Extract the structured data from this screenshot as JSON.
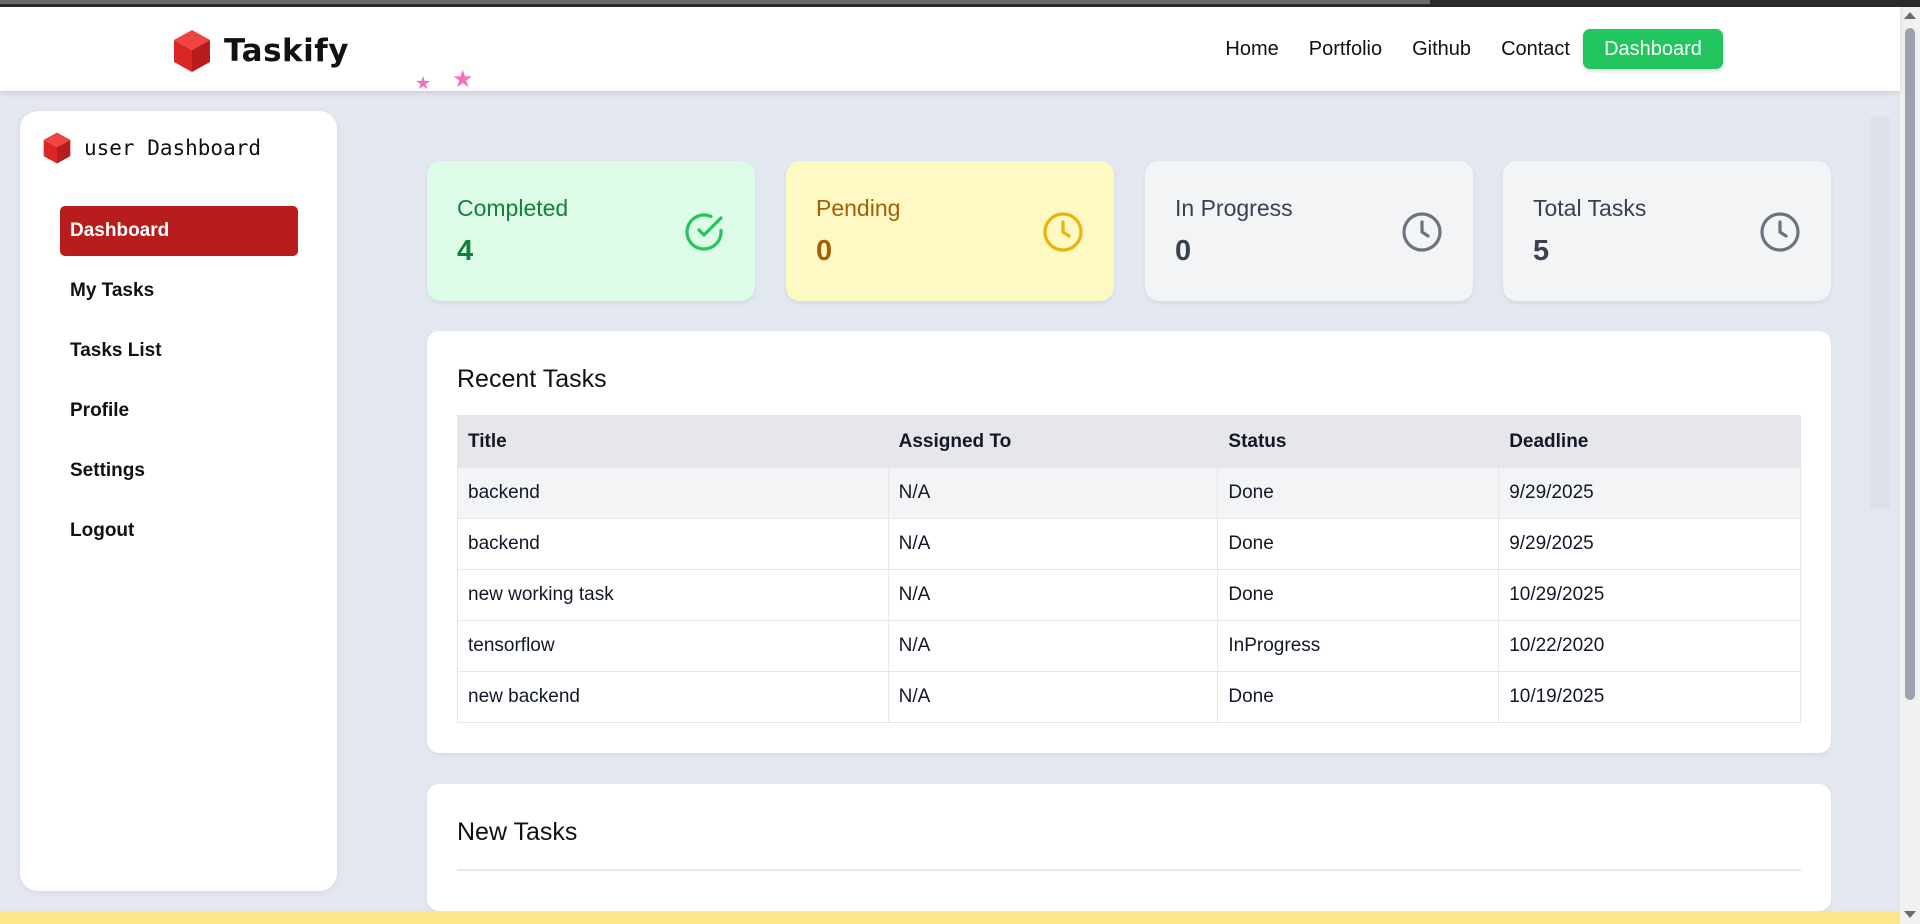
{
  "navbar": {
    "brand": "Taskify",
    "links": [
      "Home",
      "Portfolio",
      "Github",
      "Contact"
    ],
    "dashboard_button": "Dashboard"
  },
  "sidebar": {
    "title": "user Dashboard",
    "items": [
      {
        "label": "Dashboard",
        "active": true
      },
      {
        "label": "My Tasks",
        "active": false
      },
      {
        "label": "Tasks List",
        "active": false
      },
      {
        "label": "Profile",
        "active": false
      },
      {
        "label": "Settings",
        "active": false
      },
      {
        "label": "Logout",
        "active": false
      }
    ]
  },
  "stats": [
    {
      "label": "Completed",
      "value": "4",
      "icon": "check-circle-icon",
      "bg": "#dcfce7",
      "text_color": "#15803d",
      "icon_color": "#22c55e"
    },
    {
      "label": "Pending",
      "value": "0",
      "icon": "clock-icon",
      "bg": "#fef9c3",
      "text_color": "#a16207",
      "icon_color": "#eab308"
    },
    {
      "label": "In Progress",
      "value": "0",
      "icon": "clock-icon",
      "bg": "#f3f4f6",
      "text_color": "#374151",
      "icon_color": "#6b7280"
    },
    {
      "label": "Total Tasks",
      "value": "5",
      "icon": "clock-icon",
      "bg": "#f3f4f6",
      "text_color": "#374151",
      "icon_color": "#6b7280"
    }
  ],
  "recent_tasks": {
    "title": "Recent Tasks",
    "columns": [
      "Title",
      "Assigned To",
      "Status",
      "Deadline"
    ],
    "rows": [
      [
        "backend",
        "N/A",
        "Done",
        "9/29/2025"
      ],
      [
        "backend",
        "N/A",
        "Done",
        "9/29/2025"
      ],
      [
        "new working task",
        "N/A",
        "Done",
        "10/29/2025"
      ],
      [
        "tensorflow",
        "N/A",
        "InProgress",
        "10/22/2020"
      ],
      [
        "new backend",
        "N/A",
        "Done",
        "10/19/2025"
      ]
    ]
  },
  "new_tasks": {
    "title": "New Tasks"
  }
}
